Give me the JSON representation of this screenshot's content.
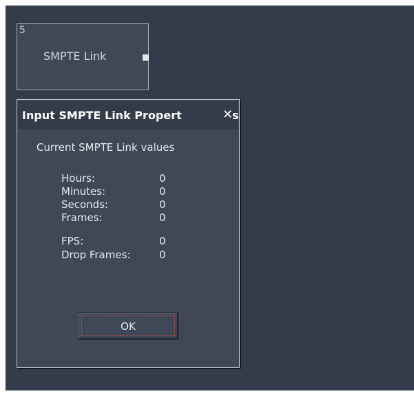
{
  "node": {
    "id": "5",
    "title": "SMPTE Link"
  },
  "dialog": {
    "title": "Input SMPTE Link Propert",
    "title_tail": "s",
    "close_glyph": "✕",
    "heading": "Current SMPTE Link values",
    "rows": [
      {
        "label": "Hours:",
        "value": "0"
      },
      {
        "label": "Minutes:",
        "value": "0"
      },
      {
        "label": "Seconds:",
        "value": "0"
      },
      {
        "label": "Frames:",
        "value": "0"
      },
      {
        "label": "FPS:",
        "value": "0"
      },
      {
        "label": "Drop Frames:",
        "value": "0"
      }
    ],
    "ok_label": "OK"
  }
}
